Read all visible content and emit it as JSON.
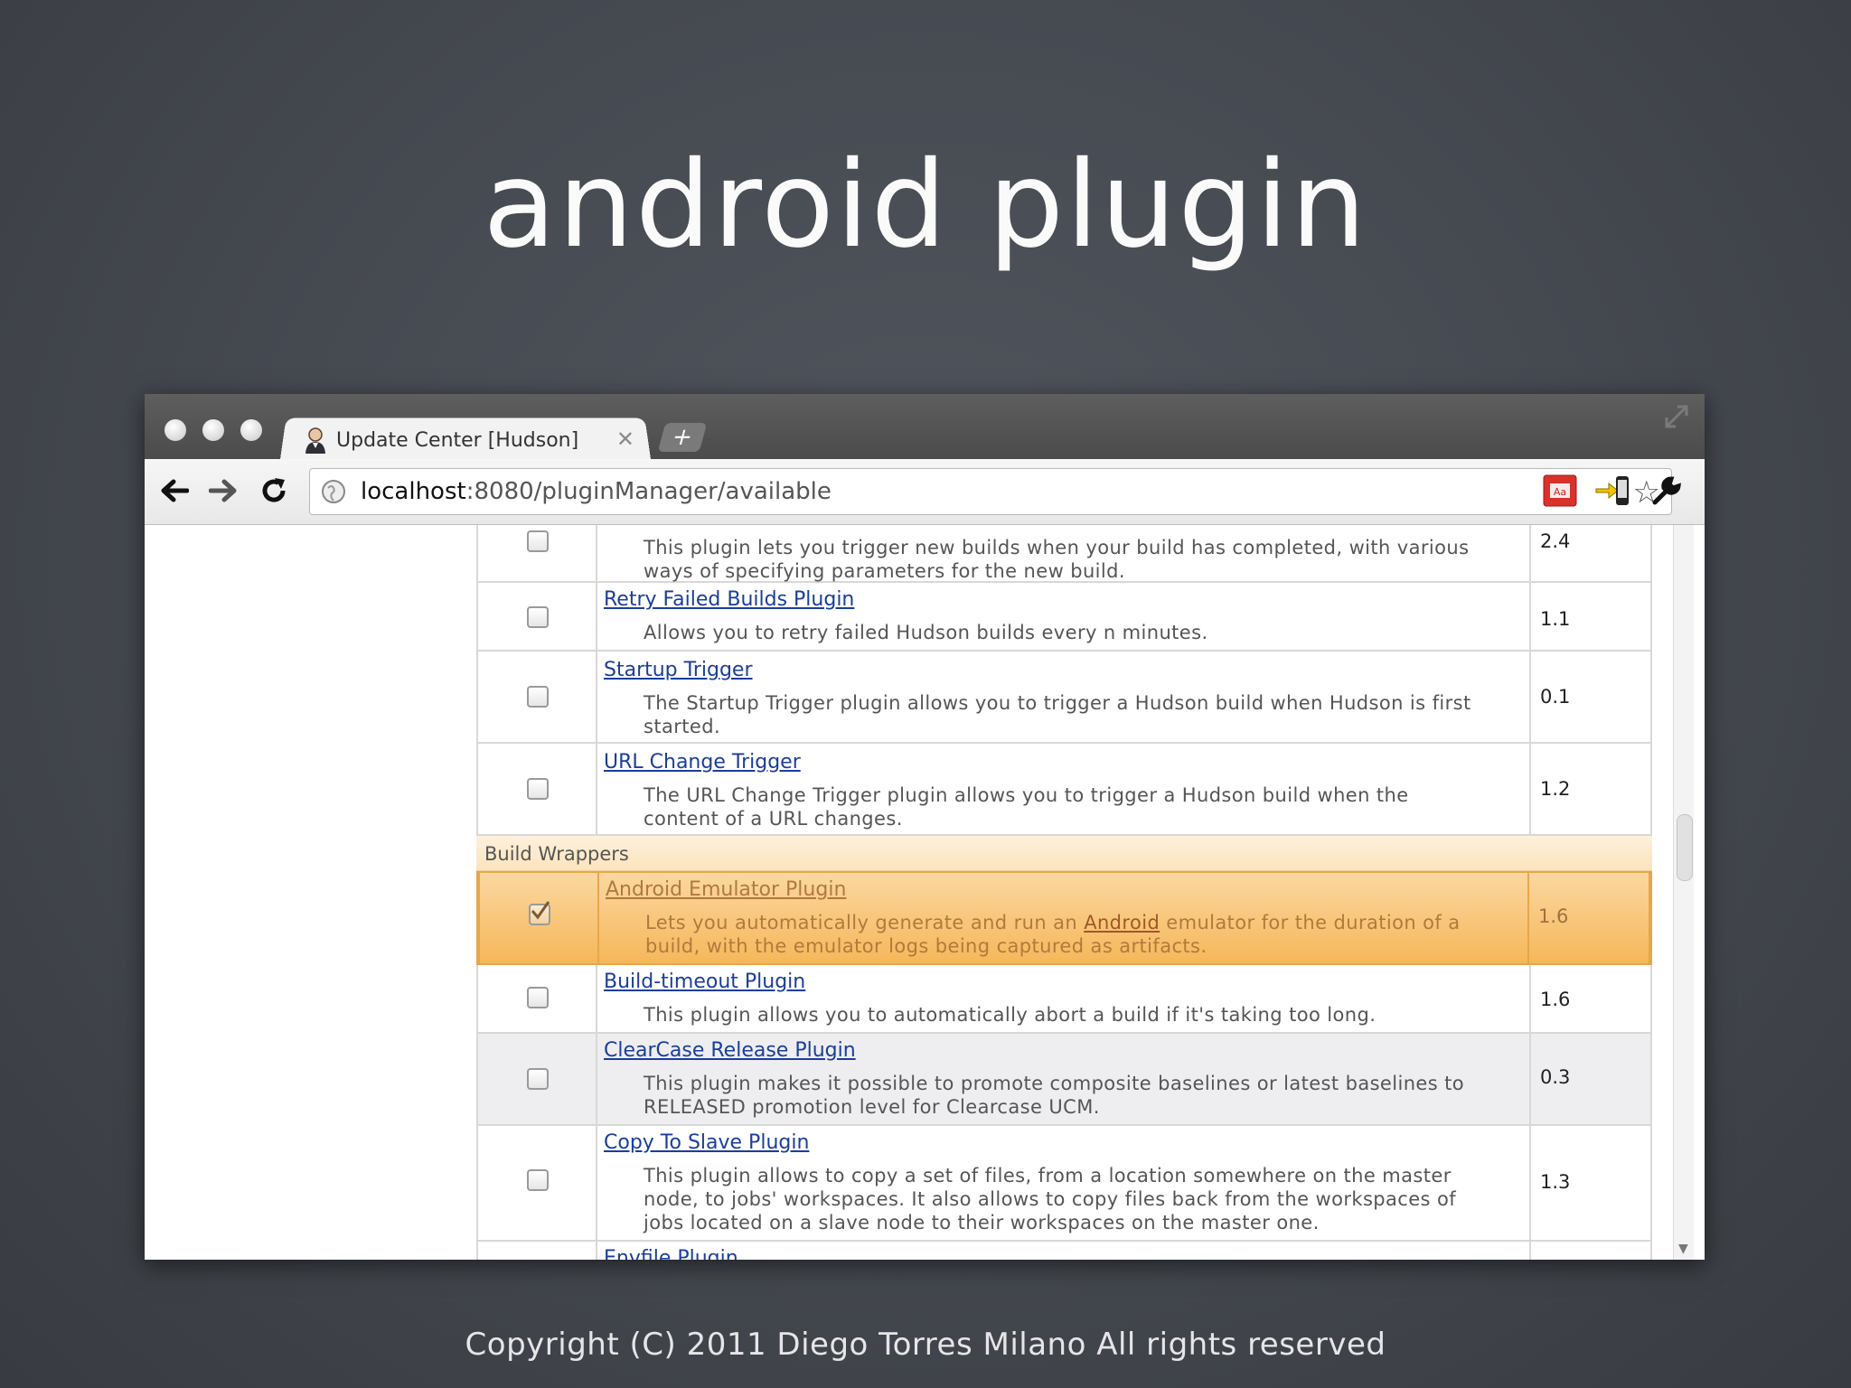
{
  "slide": {
    "title": "android plugin",
    "copyright": "Copyright (C) 2011  Diego Torres Milano  All rights reserved"
  },
  "browser": {
    "tab_title": "Update Center [Hudson]",
    "new_tab_label": "+",
    "url_host": "localhost",
    "url_path": ":8080/pluginManager/available",
    "icons": {
      "back": "back-arrow-icon",
      "forward": "forward-arrow-icon",
      "reload": "reload-icon",
      "bookmark": "star-icon",
      "extension1": "acrobat-icon",
      "extension2": "phone-send-icon",
      "settings": "wrench-icon"
    }
  },
  "plugins": {
    "top_row": {
      "desc1": "This plugin lets you trigger new builds when your build has completed, with various",
      "desc2": "ways of specifying parameters for the new build.",
      "version": "2.4"
    },
    "rows": [
      {
        "name": "Retry Failed Builds Plugin",
        "desc1": "Allows you to retry failed Hudson builds every n minutes.",
        "desc2": "",
        "version": "1.1"
      },
      {
        "name": "Startup Trigger",
        "desc1": "The Startup Trigger plugin allows you to trigger a Hudson build when Hudson is first",
        "desc2": "started.",
        "version": "0.1"
      },
      {
        "name": "URL Change Trigger",
        "desc1": "The URL Change Trigger plugin allows you to trigger a Hudson build when the",
        "desc2": "content of a URL changes.",
        "version": "1.2"
      }
    ],
    "section": "Build Wrappers",
    "selected": {
      "name": "Android Emulator Plugin",
      "desc_pre": "Lets you automatically generate and run an ",
      "desc_link": "Android",
      "desc_post": " emulator for the duration of a",
      "desc2": "build, with the emulator logs being captured as artifacts.",
      "version": "1.6",
      "checked": true
    },
    "rows2": [
      {
        "name": "Build-timeout Plugin",
        "desc1": "This plugin allows you to automatically abort a build if it's taking too long.",
        "desc2": "",
        "desc3": "",
        "version": "1.6"
      },
      {
        "name": "ClearCase Release Plugin",
        "desc1": "This plugin makes it possible to promote composite baselines or latest baselines to",
        "desc2": "RELEASED promotion level for Clearcase UCM.",
        "desc3": "",
        "version": "0.3"
      },
      {
        "name": "Copy To Slave Plugin",
        "desc1": "This plugin allows to copy a set of files, from a location somewhere on the master",
        "desc2": "node, to jobs' workspaces. It also allows to copy files back from the workspaces of",
        "desc3": "jobs located on a slave node to their workspaces on the master one.",
        "version": "1.3"
      }
    ],
    "partial_row_name": "Envfile Plugin"
  }
}
